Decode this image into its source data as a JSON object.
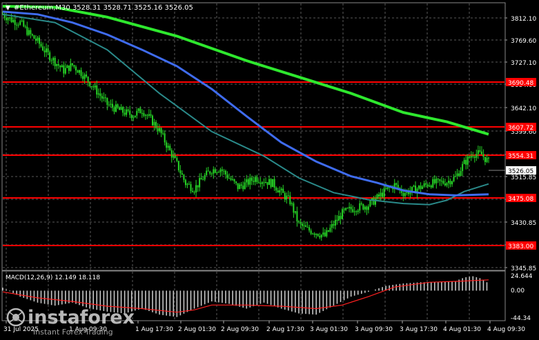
{
  "header": {
    "menu_arrow": "▼",
    "symbol_info": "#Ethereum,M30  3528.31 3528.71 3525.16 3526.05"
  },
  "colors": {
    "background": "#000000",
    "grid": "#5a5a5a",
    "candle": "#26d626",
    "ma_fast": "#2a8a8a",
    "ma_mid": "#3f6cf0",
    "ma_slow": "#2ee82e",
    "level": "#ff0000",
    "macd_hist": "#c8c8c8",
    "macd_signal": "#ff2020",
    "price_tag_bg": "#ffffff",
    "price_tag_text": "#000000"
  },
  "price_axis": {
    "ticks": [
      "3812.10",
      "3769.60",
      "3727.10",
      "3684.60",
      "3642.10",
      "3599.60",
      "3557.10",
      "3515.85",
      "3473.35",
      "3430.85",
      "3388.35",
      "3345.85"
    ],
    "current_price": "3526.05"
  },
  "levels": [
    {
      "label": "3690.48",
      "value": 3690.48
    },
    {
      "label": "3607.72",
      "value": 3607.72
    },
    {
      "label": "3554.31",
      "value": 3554.31
    },
    {
      "label": "3475.08",
      "value": 3475.08
    },
    {
      "label": "3383.00",
      "value": 3383.0
    }
  ],
  "macd": {
    "label": "MACD(12,26,9) 12.149 18.118",
    "ticks": [
      "24.644",
      "0.00",
      "-44.34"
    ]
  },
  "time_axis": {
    "labels": [
      "31 Jul 2025",
      "1 Aug 09:30",
      "1 Aug 17:30",
      "2 Aug 01:30",
      "2 Aug 09:30",
      "2 Aug 17:30",
      "3 Aug 01:30",
      "3 Aug 09:30",
      "3 Aug 17:30",
      "4 Aug 01:30",
      "4 Aug 09:30"
    ]
  },
  "watermark": {
    "brand": "instaforex",
    "tagline": "Instant Forex Trading"
  },
  "chart_data": {
    "type": "candlestick",
    "price_range": [
      3338,
      3825
    ],
    "price_path": [
      [
        0,
        3805
      ],
      [
        5,
        3795
      ],
      [
        10,
        3790
      ],
      [
        15,
        3770
      ],
      [
        20,
        3755
      ],
      [
        25,
        3735
      ],
      [
        30,
        3718
      ],
      [
        35,
        3702
      ],
      [
        40,
        3712
      ],
      [
        45,
        3698
      ],
      [
        50,
        3680
      ],
      [
        55,
        3660
      ],
      [
        60,
        3640
      ],
      [
        65,
        3632
      ],
      [
        70,
        3625
      ],
      [
        75,
        3620
      ],
      [
        80,
        3630
      ],
      [
        85,
        3612
      ],
      [
        90,
        3592
      ],
      [
        95,
        3560
      ],
      [
        100,
        3530
      ],
      [
        105,
        3495
      ],
      [
        110,
        3485
      ],
      [
        115,
        3505
      ],
      [
        120,
        3520
      ],
      [
        125,
        3522
      ],
      [
        130,
        3505
      ],
      [
        135,
        3488
      ],
      [
        140,
        3495
      ],
      [
        145,
        3505
      ],
      [
        150,
        3500
      ],
      [
        155,
        3495
      ],
      [
        160,
        3478
      ],
      [
        165,
        3462
      ],
      [
        170,
        3420
      ],
      [
        175,
        3410
      ],
      [
        180,
        3405
      ],
      [
        185,
        3398
      ],
      [
        190,
        3420
      ],
      [
        195,
        3440
      ],
      [
        200,
        3448
      ],
      [
        205,
        3452
      ],
      [
        210,
        3455
      ],
      [
        215,
        3468
      ],
      [
        220,
        3482
      ],
      [
        225,
        3492
      ],
      [
        230,
        3478
      ],
      [
        235,
        3482
      ],
      [
        240,
        3488
      ],
      [
        245,
        3495
      ],
      [
        250,
        3496
      ],
      [
        255,
        3498
      ],
      [
        260,
        3506
      ],
      [
        265,
        3532
      ],
      [
        270,
        3550
      ],
      [
        275,
        3548
      ],
      [
        279,
        3534
      ]
    ],
    "ma_fast_path": [
      [
        0,
        3805
      ],
      [
        30,
        3790
      ],
      [
        60,
        3740
      ],
      [
        90,
        3660
      ],
      [
        120,
        3590
      ],
      [
        150,
        3545
      ],
      [
        170,
        3505
      ],
      [
        190,
        3478
      ],
      [
        210,
        3465
      ],
      [
        230,
        3458
      ],
      [
        245,
        3456
      ],
      [
        255,
        3464
      ],
      [
        265,
        3480
      ],
      [
        279,
        3494
      ]
    ],
    "ma_mid_path": [
      [
        0,
        3810
      ],
      [
        20,
        3805
      ],
      [
        40,
        3790
      ],
      [
        60,
        3768
      ],
      [
        80,
        3740
      ],
      [
        100,
        3710
      ],
      [
        120,
        3668
      ],
      [
        140,
        3618
      ],
      [
        160,
        3570
      ],
      [
        180,
        3535
      ],
      [
        200,
        3508
      ],
      [
        215,
        3496
      ],
      [
        230,
        3482
      ],
      [
        245,
        3475
      ],
      [
        260,
        3473
      ],
      [
        270,
        3474
      ],
      [
        279,
        3475
      ]
    ],
    "ma_slow_path": [
      [
        0,
        3820
      ],
      [
        30,
        3818
      ],
      [
        60,
        3800
      ],
      [
        100,
        3765
      ],
      [
        140,
        3720
      ],
      [
        170,
        3690
      ],
      [
        200,
        3660
      ],
      [
        230,
        3625
      ],
      [
        255,
        3608
      ],
      [
        279,
        3585
      ]
    ],
    "macd_hist_path": [
      [
        0,
        5
      ],
      [
        10,
        -10
      ],
      [
        20,
        -20
      ],
      [
        30,
        -25
      ],
      [
        40,
        -20
      ],
      [
        50,
        -30
      ],
      [
        60,
        -35
      ],
      [
        70,
        -38
      ],
      [
        80,
        -30
      ],
      [
        90,
        -40
      ],
      [
        100,
        -44
      ],
      [
        110,
        -30
      ],
      [
        120,
        -18
      ],
      [
        130,
        -22
      ],
      [
        140,
        -30
      ],
      [
        150,
        -20
      ],
      [
        160,
        -30
      ],
      [
        170,
        -38
      ],
      [
        180,
        -40
      ],
      [
        190,
        -25
      ],
      [
        200,
        -10
      ],
      [
        210,
        -2
      ],
      [
        220,
        8
      ],
      [
        230,
        12
      ],
      [
        240,
        14
      ],
      [
        250,
        14
      ],
      [
        260,
        16
      ],
      [
        265,
        22
      ],
      [
        270,
        24
      ],
      [
        275,
        20
      ],
      [
        279,
        12
      ]
    ],
    "macd_signal_path": [
      [
        0,
        -2
      ],
      [
        20,
        -12
      ],
      [
        40,
        -18
      ],
      [
        60,
        -26
      ],
      [
        80,
        -30
      ],
      [
        100,
        -36
      ],
      [
        110,
        -32
      ],
      [
        120,
        -24
      ],
      [
        140,
        -24
      ],
      [
        160,
        -26
      ],
      [
        180,
        -30
      ],
      [
        195,
        -24
      ],
      [
        210,
        -10
      ],
      [
        225,
        6
      ],
      [
        245,
        14
      ],
      [
        265,
        16
      ],
      [
        279,
        18
      ]
    ]
  }
}
